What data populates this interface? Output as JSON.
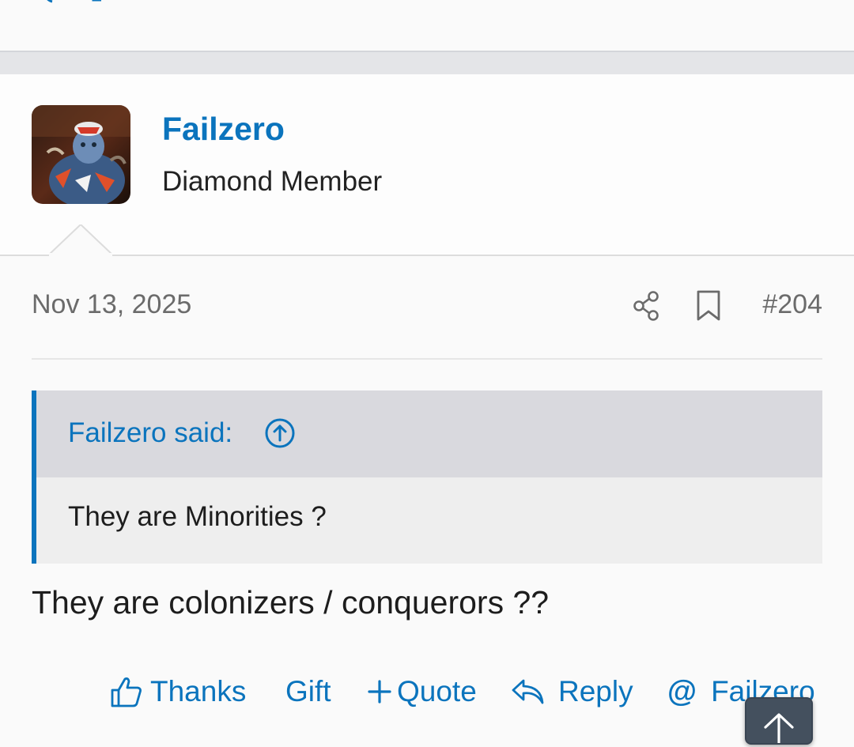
{
  "post": {
    "author": {
      "username": "Failzero",
      "title": "Diamond Member"
    },
    "date": "Nov 13, 2025",
    "number": "#204",
    "quote": {
      "author_label": "Failzero said:",
      "text": "They are Minorities ?"
    },
    "text": "They are colonizers / conquerors ??",
    "actions": {
      "thanks": "Thanks",
      "gift": "Gift",
      "quote": "Quote",
      "reply": "Reply",
      "mention": "Failzero"
    }
  },
  "icons": {
    "share": "share-icon",
    "bookmark": "bookmark-icon",
    "quote_jump": "arrow-up-circle-icon",
    "thanks": "thumbs-up-icon",
    "quote_add": "plus-icon",
    "reply": "reply-arrow-icon",
    "mention": "at-sign-icon",
    "scroll_top": "arrow-up-icon"
  },
  "colors": {
    "accent": "#0b74bd",
    "muted": "#6b6b6b",
    "quote_header": "#d9d9de",
    "quote_body": "#eeeeee",
    "scroll_button": "#44505e"
  }
}
